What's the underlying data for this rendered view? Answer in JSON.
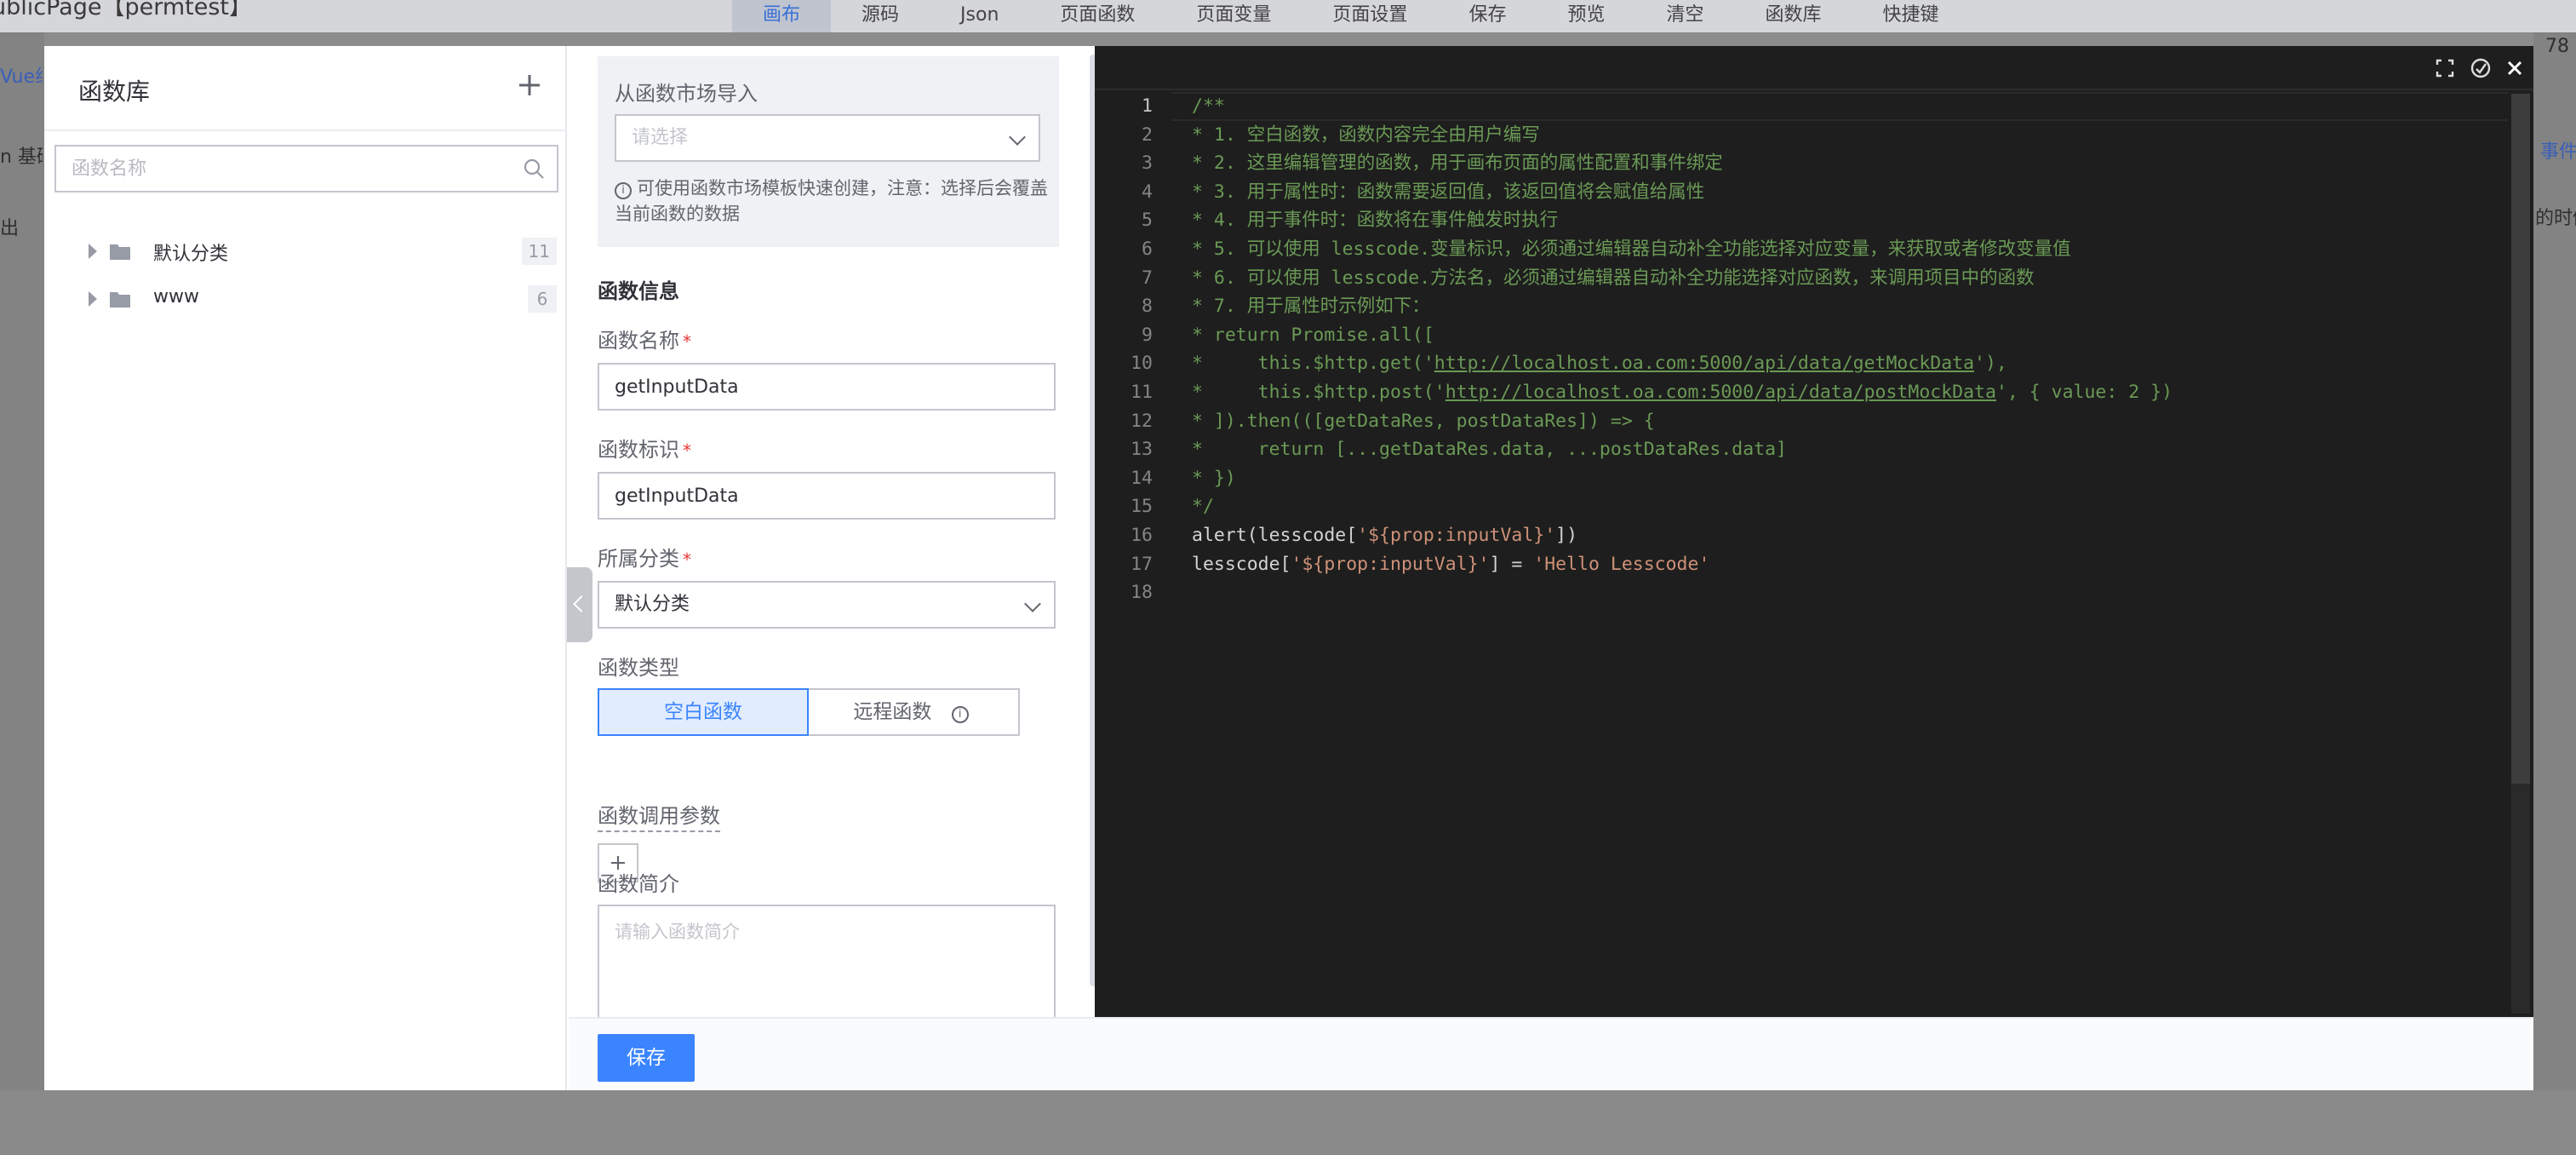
{
  "background": {
    "title": "ublicPage【permtest】",
    "toolbar": [
      "画布",
      "源码",
      "Json",
      "页面函数",
      "页面变量",
      "页面设置",
      "保存",
      "预览",
      "清空",
      "函数库",
      "快捷键"
    ],
    "left_fragments": [
      "Vue组",
      "n 基础",
      "出"
    ],
    "right_fragments": [
      "78",
      "事件",
      "的时候"
    ]
  },
  "library": {
    "title": "函数库",
    "search_placeholder": "函数名称",
    "groups": [
      {
        "label": "默认分类",
        "count": "11"
      },
      {
        "label": "www",
        "count": "6"
      }
    ]
  },
  "form": {
    "market": {
      "title": "从函数市场导入",
      "placeholder": "请选择",
      "tip": "可使用函数市场模板快速创建，注意：选择后会覆盖当前函数的数据"
    },
    "section_title": "函数信息",
    "name_label": "函数名称",
    "name_value": "getInputData",
    "id_label": "函数标识",
    "id_value": "getInputData",
    "category_label": "所属分类",
    "category_value": "默认分类",
    "type_label": "函数类型",
    "type_options": [
      "空白函数",
      "远程函数"
    ],
    "params_label": "函数调用参数",
    "desc_label": "函数简介",
    "desc_placeholder": "请输入函数简介"
  },
  "footer": {
    "save_label": "保存"
  },
  "editor": {
    "active_line": 1,
    "lines": [
      {
        "n": "1",
        "parts": [
          {
            "t": "/**",
            "c": "c-comment"
          }
        ]
      },
      {
        "n": "2",
        "parts": [
          {
            "t": "* 1. 空白函数，函数内容完全由用户编写",
            "c": "c-comment"
          }
        ]
      },
      {
        "n": "3",
        "parts": [
          {
            "t": "* 2. 这里编辑管理的函数，用于画布页面的属性配置和事件绑定",
            "c": "c-comment"
          }
        ]
      },
      {
        "n": "4",
        "parts": [
          {
            "t": "* 3. 用于属性时：函数需要返回值，该返回值将会赋值给属性",
            "c": "c-comment"
          }
        ]
      },
      {
        "n": "5",
        "parts": [
          {
            "t": "* 4. 用于事件时：函数将在事件触发时执行",
            "c": "c-comment"
          }
        ]
      },
      {
        "n": "6",
        "parts": [
          {
            "t": "* 5. 可以使用 lesscode.变量标识，必须通过编辑器自动补全功能选择对应变量，来获取或者修改变量值",
            "c": "c-comment"
          }
        ]
      },
      {
        "n": "7",
        "parts": [
          {
            "t": "* 6. 可以使用 lesscode.方法名，必须通过编辑器自动补全功能选择对应函数，来调用项目中的函数",
            "c": "c-comment"
          }
        ]
      },
      {
        "n": "8",
        "parts": [
          {
            "t": "* 7. 用于属性时示例如下：",
            "c": "c-comment"
          }
        ]
      },
      {
        "n": "9",
        "parts": [
          {
            "t": "* return Promise.all([",
            "c": "c-comment"
          }
        ]
      },
      {
        "n": "10",
        "parts": [
          {
            "t": "*     this.$http.get('",
            "c": "c-comment"
          },
          {
            "t": "http://localhost.oa.com:5000/api/data/getMockData",
            "c": "c-comment c-link"
          },
          {
            "t": "'),",
            "c": "c-comment"
          }
        ]
      },
      {
        "n": "11",
        "parts": [
          {
            "t": "*     this.$http.post('",
            "c": "c-comment"
          },
          {
            "t": "http://localhost.oa.com:5000/api/data/postMockData",
            "c": "c-comment c-link"
          },
          {
            "t": "', { value: 2 })",
            "c": "c-comment"
          }
        ]
      },
      {
        "n": "12",
        "parts": [
          {
            "t": "* ]).then(([getDataRes, postDataRes]) => {",
            "c": "c-comment"
          }
        ]
      },
      {
        "n": "13",
        "parts": [
          {
            "t": "*     return [...getDataRes.data, ...postDataRes.data]",
            "c": "c-comment"
          }
        ]
      },
      {
        "n": "14",
        "parts": [
          {
            "t": "* })",
            "c": "c-comment"
          }
        ]
      },
      {
        "n": "15",
        "parts": [
          {
            "t": "*/",
            "c": "c-comment"
          }
        ]
      },
      {
        "n": "16",
        "parts": [
          {
            "t": "alert(lesscode[",
            "c": "c-plain"
          },
          {
            "t": "'${prop:inputVal}'",
            "c": "c-string"
          },
          {
            "t": "])",
            "c": "c-plain"
          }
        ]
      },
      {
        "n": "17",
        "parts": [
          {
            "t": "lesscode[",
            "c": "c-plain"
          },
          {
            "t": "'${prop:inputVal}'",
            "c": "c-string"
          },
          {
            "t": "] = ",
            "c": "c-plain"
          },
          {
            "t": "'Hello Lesscode'",
            "c": "c-string"
          }
        ]
      },
      {
        "n": "18",
        "parts": []
      }
    ]
  },
  "colors": {
    "primary": "#3a84ff",
    "editor_bg": "#1e1e1e",
    "comment": "#6a9955",
    "string": "#ce9178"
  }
}
